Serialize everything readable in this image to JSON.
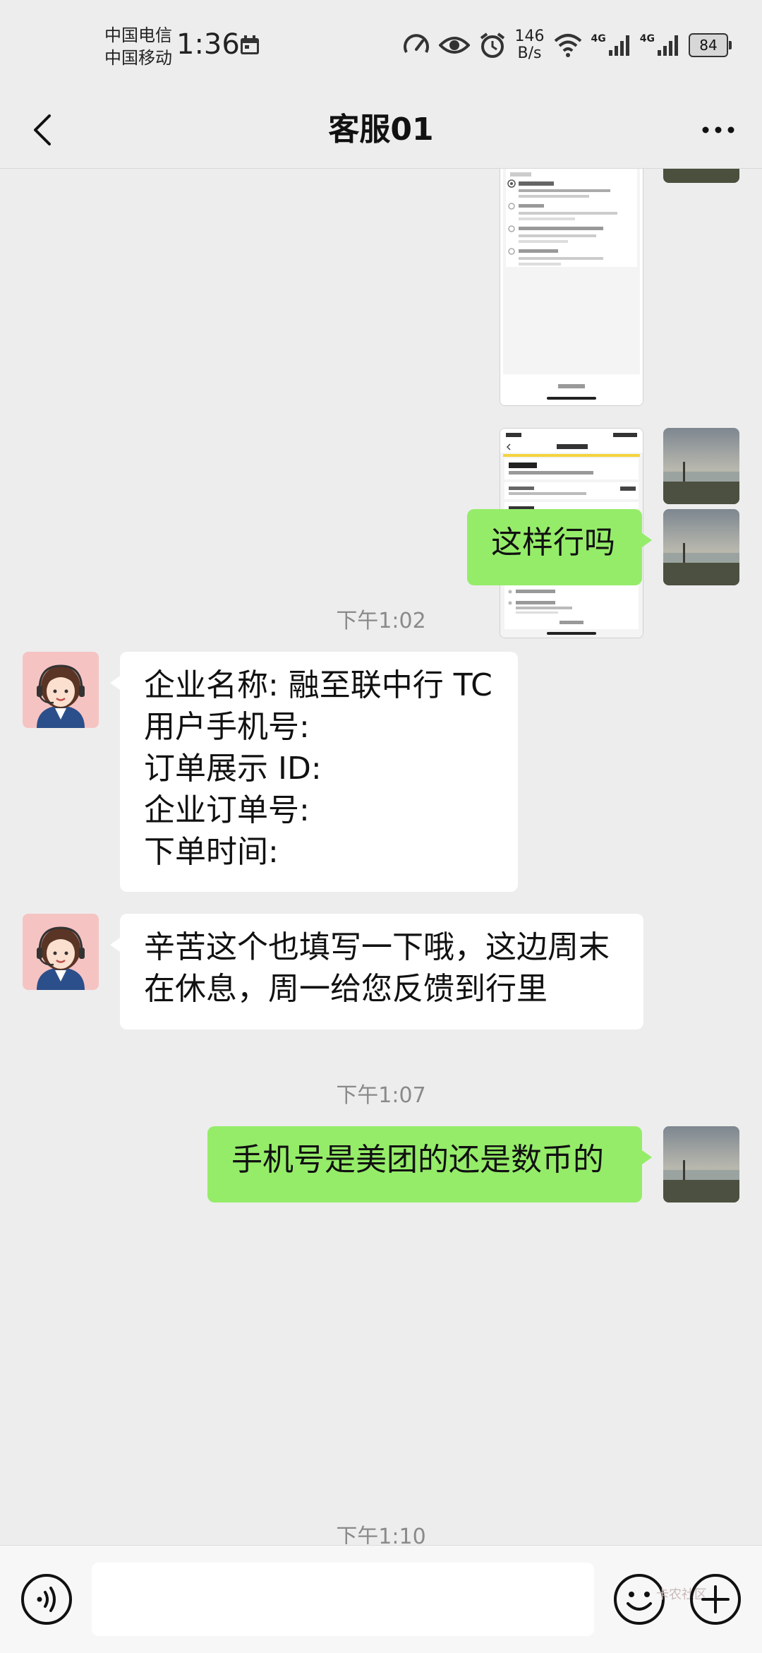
{
  "status_bar": {
    "carrier1": "中国电信",
    "carrier2": "中国移动",
    "time": "1:36",
    "net_speed_value": "146",
    "net_speed_unit": "B/s",
    "sim1_tech": "4G",
    "sim2_tech": "4G",
    "battery": "84"
  },
  "header": {
    "title": "客服01"
  },
  "messages": {
    "text1": "这样行吗",
    "ts1": "下午1:02",
    "text2": "企业名称: 融至联中行 TC\n用户手机号:\n订单展示 ID:\n企业订单号:\n下单时间:",
    "text3": "辛苦这个也填写一下哦，这边周末\n在休息，周一给您反馈到行里",
    "ts2": "下午1:07",
    "text4": "手机号是美团的还是数币的",
    "ts3": "下午1:10"
  },
  "screenshot1": {
    "steps": [
      "退款成功",
      "退款中",
      "商家已同意您的退款申请",
      "发起退款申请"
    ],
    "footer": "联系客服"
  },
  "screenshot2": {
    "time": "03:12",
    "title": "售后详情",
    "status": "退款成功",
    "amount": "¥60.60",
    "section": "退款流程",
    "footer": "联系客服"
  },
  "input": {
    "placeholder": ""
  },
  "watermark": "卡农社区",
  "colors": {
    "my_bubble": "#95ec69",
    "other_bubble": "#ffffff",
    "background": "#ededed"
  }
}
